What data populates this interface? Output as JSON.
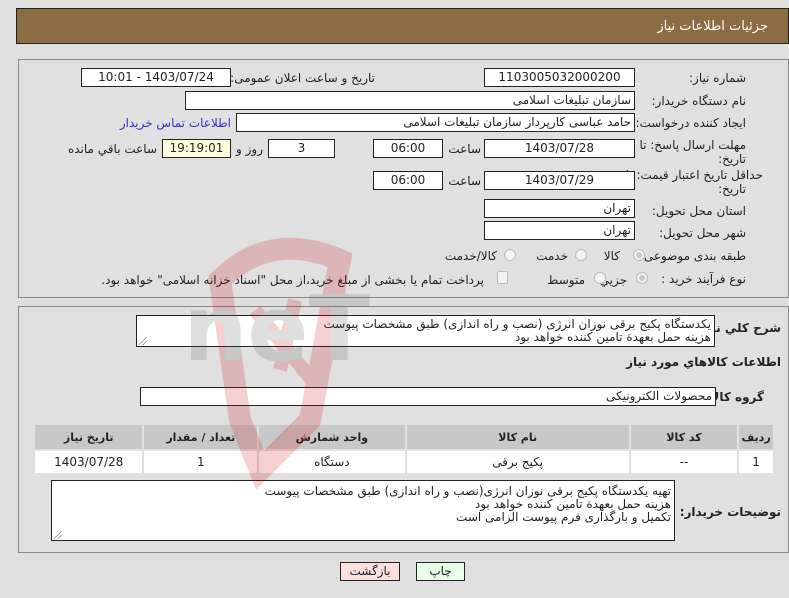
{
  "header": {
    "title": "جزئیات اطلاعات نیاز"
  },
  "details": {
    "need_number_label": "شماره نیاز:",
    "need_number": "1103005032000200",
    "announce_label": "تاریخ و ساعت اعلان عمومی:",
    "announce_value": "1403/07/24 - 10:01",
    "buyer_org_label": "نام دستگاه خریدار:",
    "buyer_org": "سازمان تبلیغات اسلامی",
    "creator_label": "ایجاد کننده درخواست:",
    "creator": "حامد عباسی کارپرداز سازمان تبلیغات اسلامی",
    "contact_link": "اطلاعات تماس خریدار",
    "reply_deadline_label_1": "مهلت ارسال پاسخ: تا",
    "reply_deadline_label_2": "تاریخ:",
    "reply_date": "1403/07/28",
    "time_label": "ساعت",
    "reply_time": "06:00",
    "days_value": "3",
    "days_label": "روز و",
    "remaining_time": "19:19:01",
    "remaining_label": "ساعت باقي مانده",
    "price_validity_label_1": "حداقل تاریخ اعتبار قیمت: تا",
    "price_validity_label_2": "تاریخ:",
    "price_validity_date": "1403/07/29",
    "price_validity_time": "06:00",
    "province_label": "استان محل تحویل:",
    "province": "تهران",
    "city_label": "شهر محل تحویل:",
    "city": "تهران",
    "category_label": "طبقه بندی موضوعی:",
    "category_options": [
      {
        "label": "کالا",
        "checked": true
      },
      {
        "label": "خدمت",
        "checked": false
      },
      {
        "label": "کالا/خدمت",
        "checked": false
      }
    ],
    "process_label": "نوع فرآیند خرید :",
    "process_options": [
      {
        "label": "جزیي",
        "checked": true
      },
      {
        "label": "متوسط",
        "checked": false
      }
    ],
    "treasury_note": "پرداخت تمام یا بخشی از مبلغ خرید،از محل \"اسناد خزانه اسلامی\" خواهد بود."
  },
  "summary": {
    "label": "شرح کلي نياز:",
    "lines": [
      "یکدستگاه پکیج برقی نوزان انرژی (نصب و راه اندازی) طبق مشخصات پیوست",
      "هزینه حمل بعهدة تامین کننده خواهد بود"
    ]
  },
  "goods": {
    "section_title": "اطلاعات کالاهاي مورد نياز",
    "group_label": "گروه کالا:",
    "group_value": "محصولات الکترونیکی",
    "table": {
      "headers": [
        "ردیف",
        "کد کالا",
        "نام کالا",
        "واحد شمارش",
        "تعداد / مقدار",
        "تاریخ نیاز"
      ],
      "rows": [
        [
          "1",
          "--",
          "پکیج برقی",
          "دستگاه",
          "1",
          "1403/07/28"
        ]
      ]
    }
  },
  "buyer_notes": {
    "label": "توضیحات خریدار:",
    "lines": [
      "تهیه یکدستگاه پکیج برقی نوزان انرژی(نصب و راه اندازی) طبق مشخصات پیوست",
      "هزینه حمل بعهدة تامین کننده خواهد بود",
      "تکمیل و بارگذاری فرم پیوست الزامی است"
    ]
  },
  "buttons": {
    "print": "چاپ",
    "back": "بازگشت"
  },
  "watermark": {
    "text": "AriaTender.neT"
  },
  "colors": {
    "title_bar": "#8b6c43",
    "link": "#3333cc",
    "remaining_bg": "#ffffe0",
    "print_bg": "#eaffea",
    "back_bg": "#ffdede"
  }
}
